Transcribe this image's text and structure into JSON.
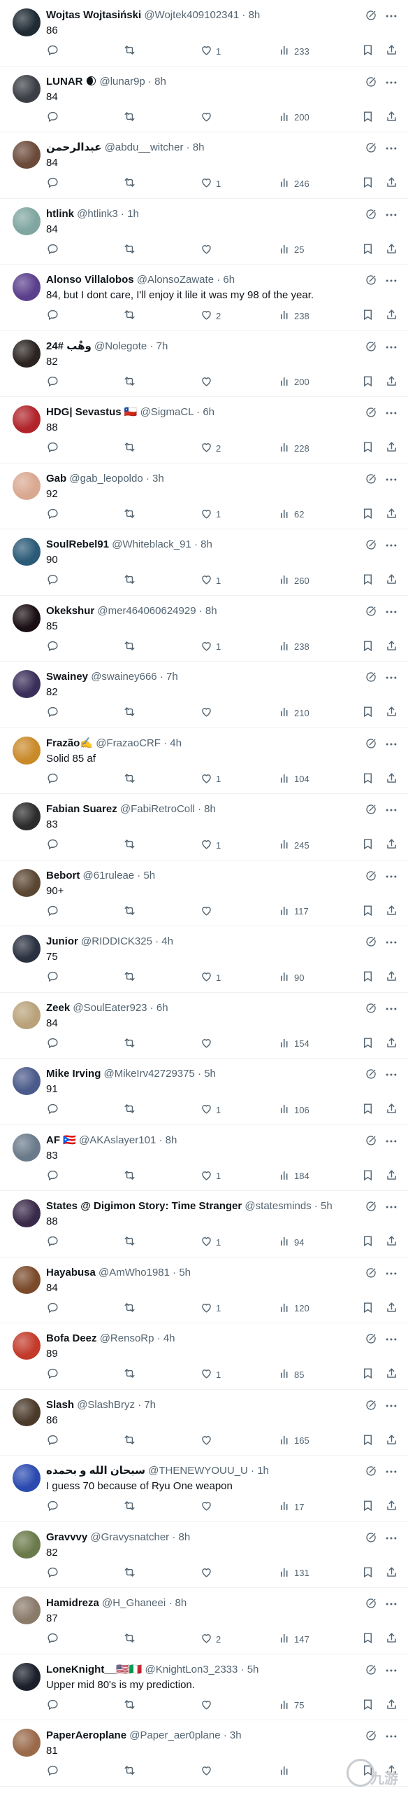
{
  "colors": {
    "text": "#0f1419",
    "muted": "#536471",
    "divider": "#eff3f4"
  },
  "icons": {
    "reply": "reply-icon",
    "retweet": "retweet-icon",
    "like": "heart-icon",
    "views": "views-icon",
    "bookmark": "bookmark-icon",
    "share": "share-icon",
    "grok": "grok-icon",
    "more": "more-icon"
  },
  "tweets": [
    {
      "name": "Wojtas Wojtasiński",
      "handle": "@Wojtek409102341",
      "time": "8h",
      "text": "86",
      "likes": "1",
      "views": "233",
      "avatar_color": "#1f2a33"
    },
    {
      "name": "LUNAR 🌒",
      "handle": "@lunar9p",
      "time": "8h",
      "text": "84",
      "likes": "",
      "views": "200",
      "avatar_color": "#3b3f45"
    },
    {
      "name": "عبدالرحمن",
      "handle": "@abdu__witcher",
      "time": "8h",
      "text": "84",
      "likes": "1",
      "views": "246",
      "avatar_color": "#6b4a3a"
    },
    {
      "name": "htlink",
      "handle": "@htlink3",
      "time": "1h",
      "text": "84",
      "likes": "",
      "views": "25",
      "avatar_color": "#7fa6a0"
    },
    {
      "name": "Alonso Villalobos",
      "handle": "@AlonsoZawate",
      "time": "6h",
      "text": "84, but I dont care, I'll enjoy it lile it was my 98 of the year.",
      "likes": "2",
      "views": "238",
      "avatar_color": "#5b3f8c"
    },
    {
      "name": "24# وهْب",
      "handle": "@Nolegote",
      "time": "7h",
      "text": "82",
      "likes": "",
      "views": "200",
      "avatar_color": "#2a2320"
    },
    {
      "name": "HDG| Sevastus 🇨🇱",
      "handle": "@SigmaCL",
      "time": "6h",
      "text": "88",
      "likes": "2",
      "views": "228",
      "avatar_color": "#b0242a"
    },
    {
      "name": "Gab",
      "handle": "@gab_leopoldo",
      "time": "3h",
      "text": "92",
      "likes": "1",
      "views": "62",
      "avatar_color": "#d9a890"
    },
    {
      "name": "SoulRebel91",
      "handle": "@Whiteblack_91",
      "time": "8h",
      "text": "90",
      "likes": "1",
      "views": "260",
      "avatar_color": "#2a5a77"
    },
    {
      "name": "Okekshur",
      "handle": "@mer464060624929",
      "time": "8h",
      "text": "85",
      "likes": "1",
      "views": "238",
      "avatar_color": "#1a0f14"
    },
    {
      "name": "Swainey",
      "handle": "@swainey666",
      "time": "7h",
      "text": "82",
      "likes": "",
      "views": "210",
      "avatar_color": "#3a2f5a"
    },
    {
      "name": "Frazão✍️",
      "handle": "@FrazaoCRF",
      "time": "4h",
      "text": "Solid 85 af",
      "likes": "1",
      "views": "104",
      "avatar_color": "#c98a2a"
    },
    {
      "name": "Fabian Suarez",
      "handle": "@FabiRetroColl",
      "time": "8h",
      "text": "83",
      "likes": "1",
      "views": "245",
      "avatar_color": "#2c2c2c"
    },
    {
      "name": "Bebort",
      "handle": "@61ruleae",
      "time": "5h",
      "text": "90+",
      "likes": "",
      "views": "117",
      "avatar_color": "#5a4632"
    },
    {
      "name": "Junior",
      "handle": "@RIDDICK325",
      "time": "4h",
      "text": "75",
      "likes": "1",
      "views": "90",
      "avatar_color": "#2a3140"
    },
    {
      "name": "Zeek",
      "handle": "@SoulEater923",
      "time": "6h",
      "text": "84",
      "likes": "",
      "views": "154",
      "avatar_color": "#b9a27a"
    },
    {
      "name": "Mike Irving",
      "handle": "@MikeIrv42729375",
      "time": "5h",
      "text": "91",
      "likes": "1",
      "views": "106",
      "avatar_color": "#4a5a8a"
    },
    {
      "name": "AF 🇵🇷",
      "handle": "@AKAslayer101",
      "time": "8h",
      "text": "83",
      "likes": "1",
      "views": "184",
      "avatar_color": "#6a7a8a"
    },
    {
      "name": "States @ Digimon Story: Time Stranger",
      "handle": "@statesminds",
      "time": "5h",
      "text": "88",
      "likes": "1",
      "views": "94",
      "avatar_color": "#3a2a4a"
    },
    {
      "name": "Hayabusa",
      "handle": "@AmWho1981",
      "time": "5h",
      "text": "84",
      "likes": "1",
      "views": "120",
      "avatar_color": "#7a4a2a"
    },
    {
      "name": "Bofa Deez",
      "handle": "@RensoRp",
      "time": "4h",
      "text": "89",
      "likes": "1",
      "views": "85",
      "avatar_color": "#c23a2a"
    },
    {
      "name": "Slash",
      "handle": "@SlashBryz",
      "time": "7h",
      "text": "86",
      "likes": "",
      "views": "165",
      "avatar_color": "#4a3a2a"
    },
    {
      "name": "سبحان الله و بحمده",
      "handle": "@THENEWYOUU_U",
      "time": "1h",
      "text": "I guess 70 because of Ryu One weapon",
      "likes": "",
      "views": "17",
      "avatar_color": "#2a4ab0"
    },
    {
      "name": "Gravvvy",
      "handle": "@Gravysnatcher",
      "time": "8h",
      "text": "82",
      "likes": "",
      "views": "131",
      "avatar_color": "#6a7a4a"
    },
    {
      "name": "Hamidreza",
      "handle": "@H_Ghaneei",
      "time": "8h",
      "text": "87",
      "likes": "2",
      "views": "147",
      "avatar_color": "#8a7a6a"
    },
    {
      "name": "LoneKnight__🇺🇸🇮🇹",
      "handle": "@KnightLon3_2333",
      "time": "5h",
      "text": "Upper mid 80's is my prediction.",
      "likes": "",
      "views": "75",
      "avatar_color": "#1a1f2a"
    },
    {
      "name": "PaperAeroplane",
      "handle": "@Paper_aer0plane",
      "time": "3h",
      "text": "81",
      "likes": "",
      "views": "",
      "avatar_color": "#9a6a4a"
    }
  ],
  "watermark": {
    "text": "九游"
  }
}
